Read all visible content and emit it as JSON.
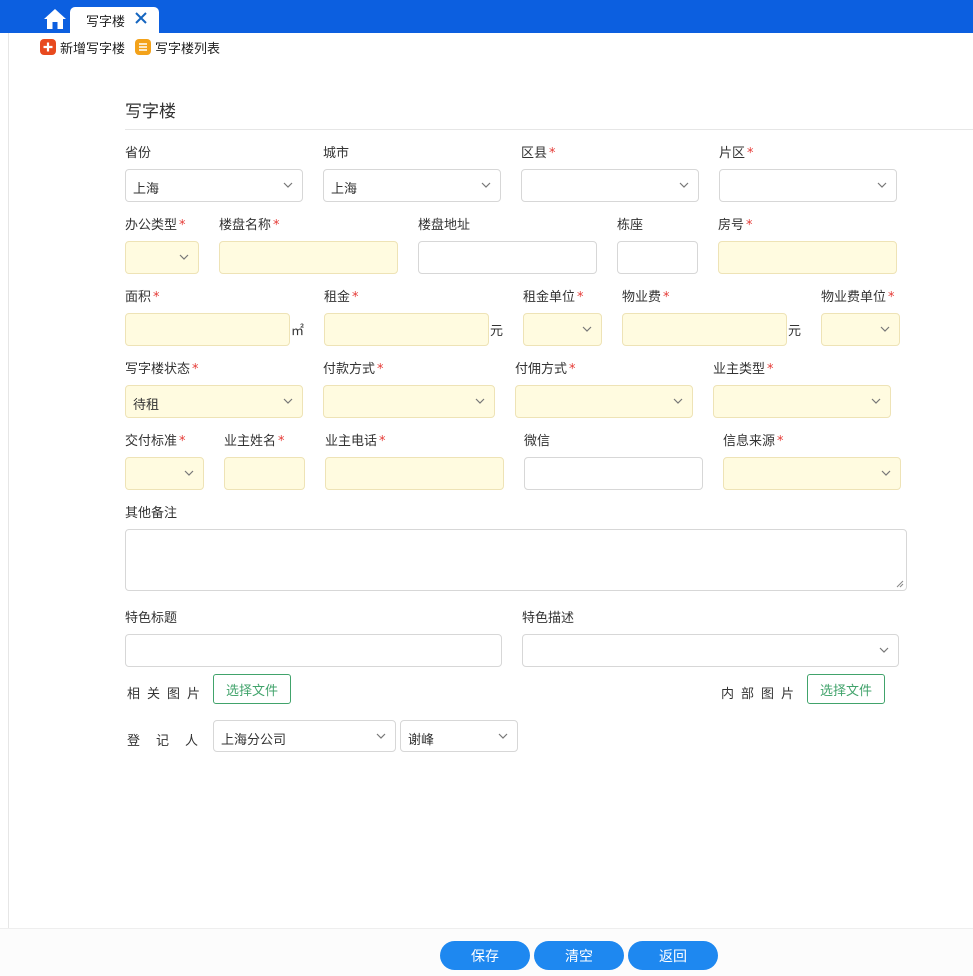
{
  "tabs": {
    "active_label": "写字楼"
  },
  "toolbar": {
    "add_label": "新增写字楼",
    "list_label": "写字楼列表"
  },
  "section": {
    "title": "写字楼"
  },
  "labels": {
    "province": "省份",
    "city": "城市",
    "district": "区县",
    "area_zone": "片区",
    "office_type": "办公类型",
    "building_name": "楼盘名称",
    "building_address": "楼盘地址",
    "block": "栋座",
    "room_no": "房号",
    "size": "面积",
    "rent": "租金",
    "rent_unit": "租金单位",
    "property_fee": "物业费",
    "property_fee_unit": "物业费单位",
    "status": "写字楼状态",
    "payment_method": "付款方式",
    "commission_method": "付佣方式",
    "owner_type": "业主类型",
    "delivery_standard": "交付标准",
    "owner_name": "业主姓名",
    "owner_phone": "业主电话",
    "wechat": "微信",
    "info_source": "信息来源",
    "remarks": "其他备注",
    "feature_title": "特色标题",
    "feature_desc": "特色描述",
    "related_images": "相关图片",
    "internal_images": "内部图片",
    "registrant": "登记人"
  },
  "required_mark": "*",
  "values": {
    "province": "上海",
    "city": "上海",
    "status": "待租",
    "registrant_company": "上海分公司",
    "registrant_person": "谢峰"
  },
  "units": {
    "sqm": "㎡",
    "yuan": "元"
  },
  "buttons": {
    "choose_file": "选择文件",
    "save": "保存",
    "clear": "清空",
    "back": "返回"
  },
  "colors": {
    "topbar": "#0c5fe0",
    "required_bg": "#fffbe0",
    "primary_button": "#1e88f0",
    "file_button": "#41a36b",
    "required_star": "#e53935"
  }
}
